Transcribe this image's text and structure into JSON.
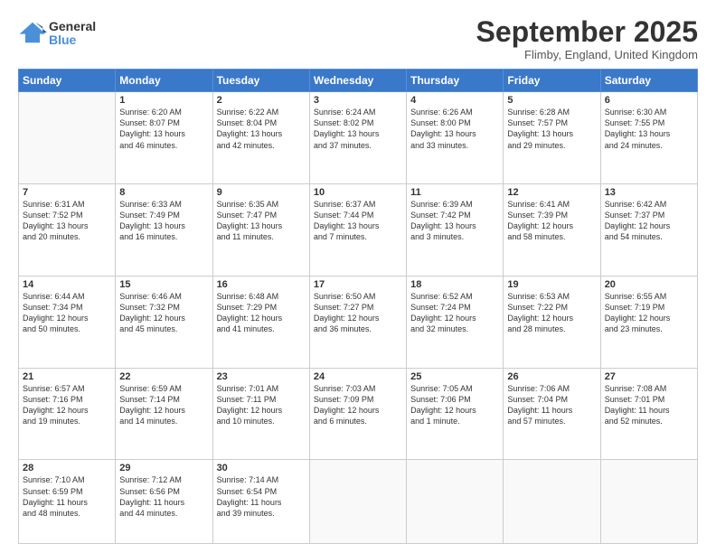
{
  "logo": {
    "general": "General",
    "blue": "Blue"
  },
  "header": {
    "month": "September 2025",
    "location": "Flimby, England, United Kingdom"
  },
  "days_of_week": [
    "Sunday",
    "Monday",
    "Tuesday",
    "Wednesday",
    "Thursday",
    "Friday",
    "Saturday"
  ],
  "weeks": [
    [
      {
        "day": "",
        "info": ""
      },
      {
        "day": "1",
        "info": "Sunrise: 6:20 AM\nSunset: 8:07 PM\nDaylight: 13 hours\nand 46 minutes."
      },
      {
        "day": "2",
        "info": "Sunrise: 6:22 AM\nSunset: 8:04 PM\nDaylight: 13 hours\nand 42 minutes."
      },
      {
        "day": "3",
        "info": "Sunrise: 6:24 AM\nSunset: 8:02 PM\nDaylight: 13 hours\nand 37 minutes."
      },
      {
        "day": "4",
        "info": "Sunrise: 6:26 AM\nSunset: 8:00 PM\nDaylight: 13 hours\nand 33 minutes."
      },
      {
        "day": "5",
        "info": "Sunrise: 6:28 AM\nSunset: 7:57 PM\nDaylight: 13 hours\nand 29 minutes."
      },
      {
        "day": "6",
        "info": "Sunrise: 6:30 AM\nSunset: 7:55 PM\nDaylight: 13 hours\nand 24 minutes."
      }
    ],
    [
      {
        "day": "7",
        "info": "Sunrise: 6:31 AM\nSunset: 7:52 PM\nDaylight: 13 hours\nand 20 minutes."
      },
      {
        "day": "8",
        "info": "Sunrise: 6:33 AM\nSunset: 7:49 PM\nDaylight: 13 hours\nand 16 minutes."
      },
      {
        "day": "9",
        "info": "Sunrise: 6:35 AM\nSunset: 7:47 PM\nDaylight: 13 hours\nand 11 minutes."
      },
      {
        "day": "10",
        "info": "Sunrise: 6:37 AM\nSunset: 7:44 PM\nDaylight: 13 hours\nand 7 minutes."
      },
      {
        "day": "11",
        "info": "Sunrise: 6:39 AM\nSunset: 7:42 PM\nDaylight: 13 hours\nand 3 minutes."
      },
      {
        "day": "12",
        "info": "Sunrise: 6:41 AM\nSunset: 7:39 PM\nDaylight: 12 hours\nand 58 minutes."
      },
      {
        "day": "13",
        "info": "Sunrise: 6:42 AM\nSunset: 7:37 PM\nDaylight: 12 hours\nand 54 minutes."
      }
    ],
    [
      {
        "day": "14",
        "info": "Sunrise: 6:44 AM\nSunset: 7:34 PM\nDaylight: 12 hours\nand 50 minutes."
      },
      {
        "day": "15",
        "info": "Sunrise: 6:46 AM\nSunset: 7:32 PM\nDaylight: 12 hours\nand 45 minutes."
      },
      {
        "day": "16",
        "info": "Sunrise: 6:48 AM\nSunset: 7:29 PM\nDaylight: 12 hours\nand 41 minutes."
      },
      {
        "day": "17",
        "info": "Sunrise: 6:50 AM\nSunset: 7:27 PM\nDaylight: 12 hours\nand 36 minutes."
      },
      {
        "day": "18",
        "info": "Sunrise: 6:52 AM\nSunset: 7:24 PM\nDaylight: 12 hours\nand 32 minutes."
      },
      {
        "day": "19",
        "info": "Sunrise: 6:53 AM\nSunset: 7:22 PM\nDaylight: 12 hours\nand 28 minutes."
      },
      {
        "day": "20",
        "info": "Sunrise: 6:55 AM\nSunset: 7:19 PM\nDaylight: 12 hours\nand 23 minutes."
      }
    ],
    [
      {
        "day": "21",
        "info": "Sunrise: 6:57 AM\nSunset: 7:16 PM\nDaylight: 12 hours\nand 19 minutes."
      },
      {
        "day": "22",
        "info": "Sunrise: 6:59 AM\nSunset: 7:14 PM\nDaylight: 12 hours\nand 14 minutes."
      },
      {
        "day": "23",
        "info": "Sunrise: 7:01 AM\nSunset: 7:11 PM\nDaylight: 12 hours\nand 10 minutes."
      },
      {
        "day": "24",
        "info": "Sunrise: 7:03 AM\nSunset: 7:09 PM\nDaylight: 12 hours\nand 6 minutes."
      },
      {
        "day": "25",
        "info": "Sunrise: 7:05 AM\nSunset: 7:06 PM\nDaylight: 12 hours\nand 1 minute."
      },
      {
        "day": "26",
        "info": "Sunrise: 7:06 AM\nSunset: 7:04 PM\nDaylight: 11 hours\nand 57 minutes."
      },
      {
        "day": "27",
        "info": "Sunrise: 7:08 AM\nSunset: 7:01 PM\nDaylight: 11 hours\nand 52 minutes."
      }
    ],
    [
      {
        "day": "28",
        "info": "Sunrise: 7:10 AM\nSunset: 6:59 PM\nDaylight: 11 hours\nand 48 minutes."
      },
      {
        "day": "29",
        "info": "Sunrise: 7:12 AM\nSunset: 6:56 PM\nDaylight: 11 hours\nand 44 minutes."
      },
      {
        "day": "30",
        "info": "Sunrise: 7:14 AM\nSunset: 6:54 PM\nDaylight: 11 hours\nand 39 minutes."
      },
      {
        "day": "",
        "info": ""
      },
      {
        "day": "",
        "info": ""
      },
      {
        "day": "",
        "info": ""
      },
      {
        "day": "",
        "info": ""
      }
    ]
  ]
}
